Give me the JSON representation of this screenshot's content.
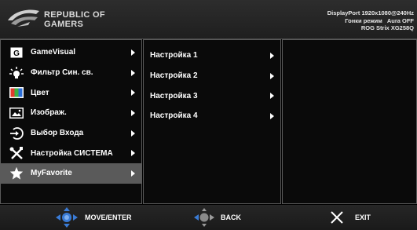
{
  "header": {
    "brand_line1": "REPUBLIC OF",
    "brand_line2": "GAMERS",
    "status_line1": "DisplayPort 1920x1080@240Hz",
    "mode_label": "Гонки режим",
    "aura_label": "Aura OFF",
    "model": "ROG Strix XG258Q"
  },
  "main_menu": {
    "items": [
      {
        "label": "GameVisual",
        "icon": "gamevisual-icon"
      },
      {
        "label": "Фильтр Син. св.",
        "icon": "blue-light-icon"
      },
      {
        "label": "Цвет",
        "icon": "color-icon"
      },
      {
        "label": "Изображ.",
        "icon": "image-icon"
      },
      {
        "label": "Выбор Входа",
        "icon": "input-select-icon"
      },
      {
        "label": "Настройка СИСТЕМА",
        "icon": "system-setup-icon"
      },
      {
        "label": "MyFavorite",
        "icon": "star-icon",
        "selected": true
      }
    ]
  },
  "sub_menu": {
    "items": [
      {
        "label": "Настройка 1"
      },
      {
        "label": "Настройка 2"
      },
      {
        "label": "Настройка 3"
      },
      {
        "label": "Настройка 4"
      }
    ]
  },
  "footer": {
    "move_label": "MOVE/ENTER",
    "back_label": "BACK",
    "exit_label": "EXIT"
  },
  "colors": {
    "background": "#000000",
    "selected": "#5a5a5a",
    "nav_blue": "#3a7bd5",
    "border": "#5a5a5a"
  }
}
